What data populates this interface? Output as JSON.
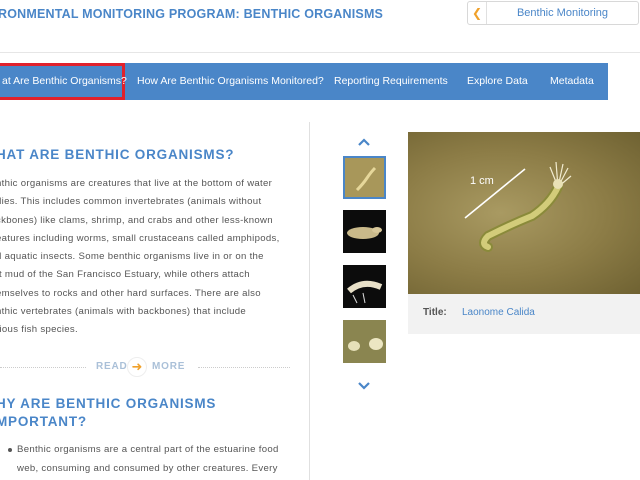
{
  "header": {
    "site_title": "RONMENTAL MONITORING PROGRAM: BENTHIC ORGANISMS",
    "breadcrumb_label": "Benthic Monitoring"
  },
  "nav": {
    "items": [
      {
        "label": "at Are Benthic Organisms?",
        "active": true
      },
      {
        "label": "How Are Benthic Organisms Monitored?",
        "active": false
      },
      {
        "label": "Reporting Requirements",
        "active": false
      },
      {
        "label": "Explore Data",
        "active": false
      },
      {
        "label": "Metadata",
        "active": false
      }
    ]
  },
  "content": {
    "heading1": "HAT ARE BENTHIC ORGANISMS?",
    "paragraph_lines": [
      "nthic organisms are creatures that live at the bottom of water",
      "dies. This includes common invertebrates (animals without",
      "ckbones) like clams, shrimp, and crabs and other less-known",
      "eatures including worms, small crustaceans called amphipods,",
      "d aquatic insects. Some benthic organisms live in or on the",
      "ft mud of the San Francisco Estuary, while others attach",
      "emselves to rocks and other hard surfaces. There are also",
      "nthic vertebrates (animals with backbones) that include",
      "rious fish species."
    ],
    "read_label": "READ",
    "more_label": "MORE",
    "heading2_line1": "HY ARE BENTHIC ORGANISMS",
    "heading2_line2": "MPORTANT?",
    "bullet_lines": [
      "Benthic organisms are a central part of the estuarine food",
      "web, consuming and consumed by other creatures. Every"
    ]
  },
  "gallery": {
    "scale_label": "1 cm",
    "caption_label": "Title:",
    "caption_value": "Laonome Calida",
    "selected_thumb": 0
  },
  "colors": {
    "brand_blue": "#4a86c8",
    "accent_orange": "#f0a12b",
    "active_outline": "#e0212c"
  }
}
